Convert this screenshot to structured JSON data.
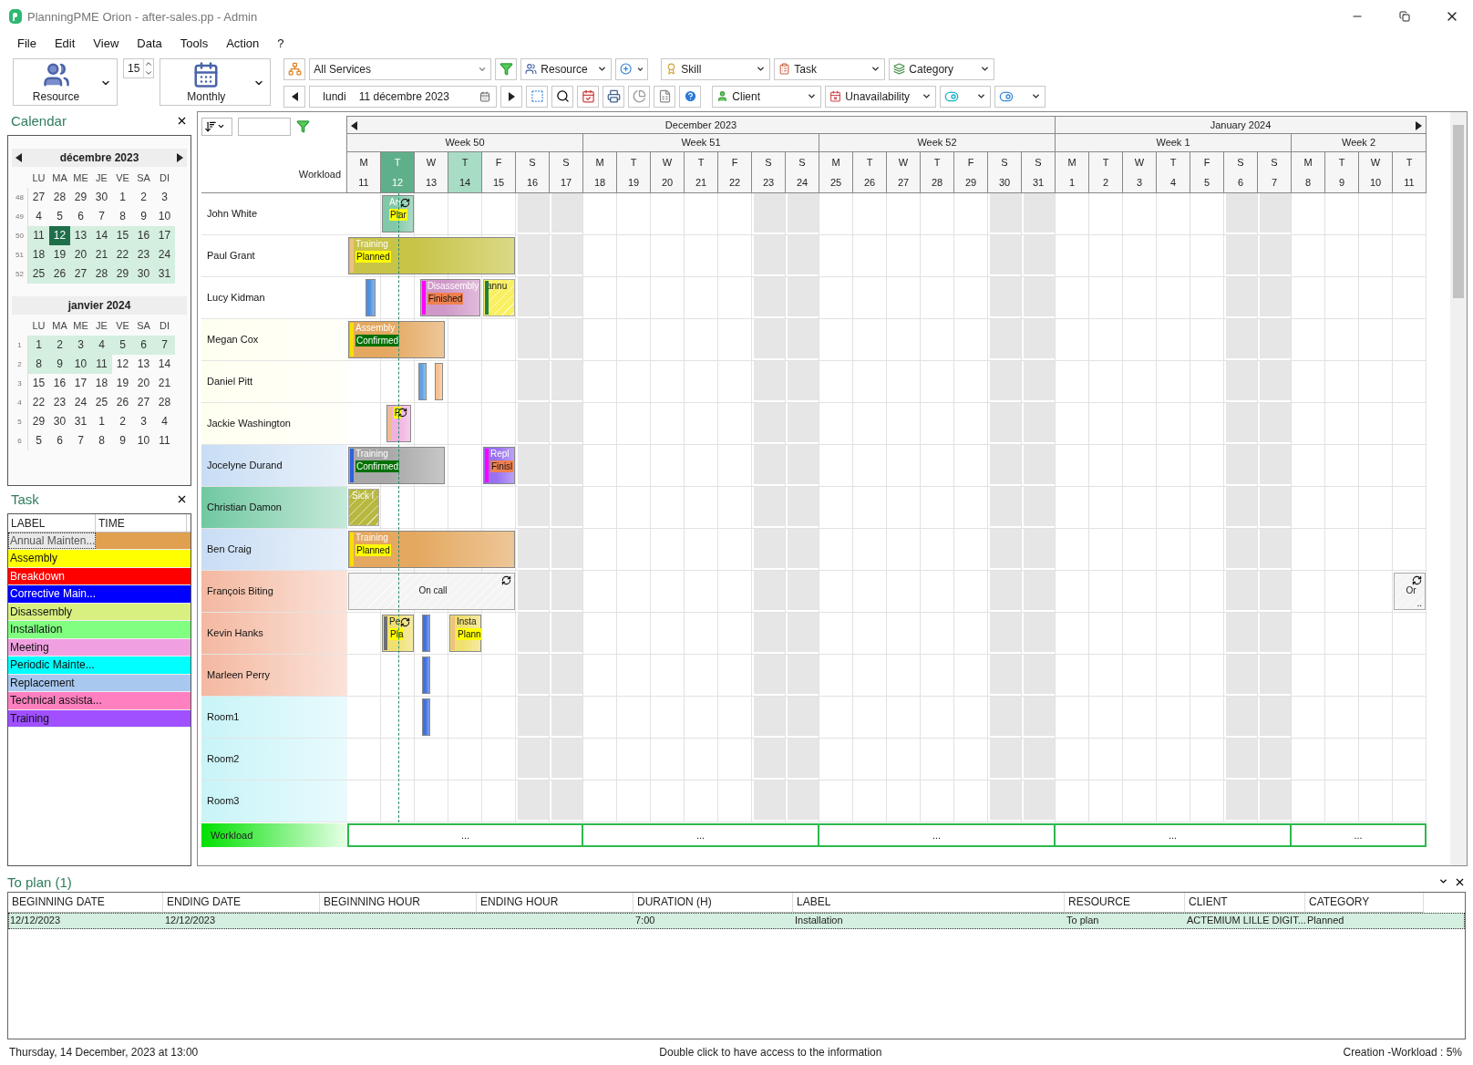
{
  "window": {
    "title": "PlanningPME Orion - after-sales.pp - Admin"
  },
  "menu": [
    "File",
    "Edit",
    "View",
    "Data",
    "Tools",
    "Action",
    "?"
  ],
  "toolbar": {
    "view_button": "Resource",
    "zoom": "15",
    "period_button": "Monthly",
    "services": "All Services",
    "resource_filter": "Resource",
    "skill": "Skill",
    "task": "Task",
    "category": "Category",
    "day_name": "lundi",
    "date": "11 décembre 2023",
    "client": "Client",
    "unavailability": "Unavailability"
  },
  "calendar": {
    "title": "Calendar",
    "months": [
      {
        "title": "décembre 2023",
        "weekday_headers": [
          "LU",
          "MA",
          "ME",
          "JE",
          "VE",
          "SA",
          "DI"
        ],
        "weeks": [
          {
            "number": "48",
            "days": [
              {
                "d": "27",
                "in_view": false,
                "selected": false
              },
              {
                "d": "28",
                "in_view": false,
                "selected": false
              },
              {
                "d": "29",
                "in_view": false,
                "selected": false
              },
              {
                "d": "30",
                "in_view": false,
                "selected": false
              },
              {
                "d": "1",
                "in_view": false,
                "selected": false
              },
              {
                "d": "2",
                "in_view": false,
                "selected": false
              },
              {
                "d": "3",
                "in_view": false,
                "selected": false
              }
            ]
          },
          {
            "number": "49",
            "days": [
              {
                "d": "4",
                "in_view": false,
                "selected": false
              },
              {
                "d": "5",
                "in_view": false,
                "selected": false
              },
              {
                "d": "6",
                "in_view": false,
                "selected": false
              },
              {
                "d": "7",
                "in_view": false,
                "selected": false
              },
              {
                "d": "8",
                "in_view": false,
                "selected": false
              },
              {
                "d": "9",
                "in_view": false,
                "selected": false
              },
              {
                "d": "10",
                "in_view": false,
                "selected": false
              }
            ]
          },
          {
            "number": "50",
            "days": [
              {
                "d": "11",
                "in_view": true,
                "selected": false
              },
              {
                "d": "12",
                "in_view": true,
                "selected": true
              },
              {
                "d": "13",
                "in_view": true,
                "selected": false
              },
              {
                "d": "14",
                "in_view": true,
                "selected": false
              },
              {
                "d": "15",
                "in_view": true,
                "selected": false
              },
              {
                "d": "16",
                "in_view": true,
                "selected": false
              },
              {
                "d": "17",
                "in_view": true,
                "selected": false
              }
            ]
          },
          {
            "number": "51",
            "days": [
              {
                "d": "18",
                "in_view": true,
                "selected": false
              },
              {
                "d": "19",
                "in_view": true,
                "selected": false
              },
              {
                "d": "20",
                "in_view": true,
                "selected": false
              },
              {
                "d": "21",
                "in_view": true,
                "selected": false
              },
              {
                "d": "22",
                "in_view": true,
                "selected": false
              },
              {
                "d": "23",
                "in_view": true,
                "selected": false
              },
              {
                "d": "24",
                "in_view": true,
                "selected": false
              }
            ]
          },
          {
            "number": "52",
            "days": [
              {
                "d": "25",
                "in_view": true,
                "selected": false
              },
              {
                "d": "26",
                "in_view": true,
                "selected": false
              },
              {
                "d": "27",
                "in_view": true,
                "selected": false
              },
              {
                "d": "28",
                "in_view": true,
                "selected": false
              },
              {
                "d": "29",
                "in_view": true,
                "selected": false
              },
              {
                "d": "30",
                "in_view": true,
                "selected": false
              },
              {
                "d": "31",
                "in_view": true,
                "selected": false
              }
            ]
          }
        ]
      },
      {
        "title": "janvier 2024",
        "weekday_headers": [
          "LU",
          "MA",
          "ME",
          "JE",
          "VE",
          "SA",
          "DI"
        ],
        "weeks": [
          {
            "number": "1",
            "days": [
              {
                "d": "1",
                "in_view": true,
                "selected": false
              },
              {
                "d": "2",
                "in_view": true,
                "selected": false
              },
              {
                "d": "3",
                "in_view": true,
                "selected": false
              },
              {
                "d": "4",
                "in_view": true,
                "selected": false
              },
              {
                "d": "5",
                "in_view": true,
                "selected": false
              },
              {
                "d": "6",
                "in_view": true,
                "selected": false
              },
              {
                "d": "7",
                "in_view": true,
                "selected": false
              }
            ]
          },
          {
            "number": "2",
            "days": [
              {
                "d": "8",
                "in_view": true,
                "selected": false
              },
              {
                "d": "9",
                "in_view": true,
                "selected": false
              },
              {
                "d": "10",
                "in_view": true,
                "selected": false
              },
              {
                "d": "11",
                "in_view": true,
                "selected": false
              },
              {
                "d": "12",
                "in_view": false,
                "selected": false
              },
              {
                "d": "13",
                "in_view": false,
                "selected": false
              },
              {
                "d": "14",
                "in_view": false,
                "selected": false
              }
            ]
          },
          {
            "number": "3",
            "days": [
              {
                "d": "15",
                "in_view": false,
                "selected": false
              },
              {
                "d": "16",
                "in_view": false,
                "selected": false
              },
              {
                "d": "17",
                "in_view": false,
                "selected": false
              },
              {
                "d": "18",
                "in_view": false,
                "selected": false
              },
              {
                "d": "19",
                "in_view": false,
                "selected": false
              },
              {
                "d": "20",
                "in_view": false,
                "selected": false
              },
              {
                "d": "21",
                "in_view": false,
                "selected": false
              }
            ]
          },
          {
            "number": "4",
            "days": [
              {
                "d": "22",
                "in_view": false,
                "selected": false
              },
              {
                "d": "23",
                "in_view": false,
                "selected": false
              },
              {
                "d": "24",
                "in_view": false,
                "selected": false
              },
              {
                "d": "25",
                "in_view": false,
                "selected": false
              },
              {
                "d": "26",
                "in_view": false,
                "selected": false
              },
              {
                "d": "27",
                "in_view": false,
                "selected": false
              },
              {
                "d": "28",
                "in_view": false,
                "selected": false
              }
            ]
          },
          {
            "number": "5",
            "days": [
              {
                "d": "29",
                "in_view": false,
                "selected": false
              },
              {
                "d": "30",
                "in_view": false,
                "selected": false
              },
              {
                "d": "31",
                "in_view": false,
                "selected": false
              },
              {
                "d": "1",
                "in_view": false,
                "selected": false
              },
              {
                "d": "2",
                "in_view": false,
                "selected": false
              },
              {
                "d": "3",
                "in_view": false,
                "selected": false
              },
              {
                "d": "4",
                "in_view": false,
                "selected": false
              }
            ]
          },
          {
            "number": "6",
            "days": [
              {
                "d": "5",
                "in_view": false,
                "selected": false
              },
              {
                "d": "6",
                "in_view": false,
                "selected": false
              },
              {
                "d": "7",
                "in_view": false,
                "selected": false
              },
              {
                "d": "8",
                "in_view": false,
                "selected": false
              },
              {
                "d": "9",
                "in_view": false,
                "selected": false
              },
              {
                "d": "10",
                "in_view": false,
                "selected": false
              },
              {
                "d": "11",
                "in_view": false,
                "selected": false
              }
            ]
          }
        ]
      }
    ]
  },
  "task_panel": {
    "title": "Task",
    "columns": [
      "LABEL",
      "TIME"
    ],
    "items": [
      {
        "label": "Annual Mainten...",
        "color": "#e0a050",
        "selected": true
      },
      {
        "label": "Assembly",
        "color": "#ffff00",
        "selected": false
      },
      {
        "label": "Breakdown",
        "color": "#ff0000",
        "selected": false
      },
      {
        "label": "Corrective Main...",
        "color": "#0000ff",
        "selected": false
      },
      {
        "label": "Disassembly",
        "color": "#d8f080",
        "selected": false
      },
      {
        "label": "Installation",
        "color": "#80ff80",
        "selected": false
      },
      {
        "label": "Meeting",
        "color": "#f0a0e0",
        "selected": false
      },
      {
        "label": "Periodic Mainte...",
        "color": "#00ffff",
        "selected": false
      },
      {
        "label": "Replacement",
        "color": "#a8c8f0",
        "selected": false
      },
      {
        "label": "Technical assista...",
        "color": "#ff80c0",
        "selected": false
      },
      {
        "label": "Training",
        "color": "#a050ff",
        "selected": false
      }
    ]
  },
  "planning": {
    "header_label": "Workload",
    "months": [
      {
        "label": "December 2023",
        "weeks": [
          {
            "label": "Week 50",
            "days": [
              {
                "letter": "M",
                "number": "11",
                "weekend": false,
                "today": false,
                "highlighted": false
              },
              {
                "letter": "T",
                "number": "12",
                "weekend": false,
                "today": true,
                "highlighted": false
              },
              {
                "letter": "W",
                "number": "13",
                "weekend": false,
                "today": false,
                "highlighted": false
              },
              {
                "letter": "T",
                "number": "14",
                "weekend": false,
                "today": false,
                "highlighted": true
              },
              {
                "letter": "F",
                "number": "15",
                "weekend": false,
                "today": false,
                "highlighted": false
              },
              {
                "letter": "S",
                "number": "16",
                "weekend": true,
                "today": false,
                "highlighted": false
              },
              {
                "letter": "S",
                "number": "17",
                "weekend": true,
                "today": false,
                "highlighted": false
              }
            ]
          },
          {
            "label": "Week 51",
            "days": [
              {
                "letter": "M",
                "number": "18",
                "weekend": false,
                "today": false,
                "highlighted": false
              },
              {
                "letter": "T",
                "number": "19",
                "weekend": false,
                "today": false,
                "highlighted": false
              },
              {
                "letter": "W",
                "number": "20",
                "weekend": false,
                "today": false,
                "highlighted": false
              },
              {
                "letter": "T",
                "number": "21",
                "weekend": false,
                "today": false,
                "highlighted": false
              },
              {
                "letter": "F",
                "number": "22",
                "weekend": false,
                "today": false,
                "highlighted": false
              },
              {
                "letter": "S",
                "number": "23",
                "weekend": true,
                "today": false,
                "highlighted": false
              },
              {
                "letter": "S",
                "number": "24",
                "weekend": true,
                "today": false,
                "highlighted": false
              }
            ]
          },
          {
            "label": "Week 52",
            "days": [
              {
                "letter": "M",
                "number": "25",
                "weekend": false,
                "today": false,
                "highlighted": false
              },
              {
                "letter": "T",
                "number": "26",
                "weekend": false,
                "today": false,
                "highlighted": false
              },
              {
                "letter": "W",
                "number": "27",
                "weekend": false,
                "today": false,
                "highlighted": false
              },
              {
                "letter": "T",
                "number": "28",
                "weekend": false,
                "today": false,
                "highlighted": false
              },
              {
                "letter": "F",
                "number": "29",
                "weekend": false,
                "today": false,
                "highlighted": false
              },
              {
                "letter": "S",
                "number": "30",
                "weekend": true,
                "today": false,
                "highlighted": false
              },
              {
                "letter": "S",
                "number": "31",
                "weekend": true,
                "today": false,
                "highlighted": false
              }
            ]
          }
        ]
      },
      {
        "label": "January 2024",
        "weeks": [
          {
            "label": "Week 1",
            "days": [
              {
                "letter": "M",
                "number": "1",
                "weekend": false,
                "today": false,
                "highlighted": false
              },
              {
                "letter": "T",
                "number": "2",
                "weekend": false,
                "today": false,
                "highlighted": false
              },
              {
                "letter": "W",
                "number": "3",
                "weekend": false,
                "today": false,
                "highlighted": false
              },
              {
                "letter": "T",
                "number": "4",
                "weekend": false,
                "today": false,
                "highlighted": false
              },
              {
                "letter": "F",
                "number": "5",
                "weekend": false,
                "today": false,
                "highlighted": false
              },
              {
                "letter": "S",
                "number": "6",
                "weekend": true,
                "today": false,
                "highlighted": false
              },
              {
                "letter": "S",
                "number": "7",
                "weekend": true,
                "today": false,
                "highlighted": false
              }
            ]
          },
          {
            "label": "Week 2",
            "days": [
              {
                "letter": "M",
                "number": "8",
                "weekend": false,
                "today": false,
                "highlighted": false
              },
              {
                "letter": "T",
                "number": "9",
                "weekend": false,
                "today": false,
                "highlighted": false
              },
              {
                "letter": "W",
                "number": "10",
                "weekend": false,
                "today": false,
                "highlighted": false
              },
              {
                "letter": "T",
                "number": "11",
                "weekend": false,
                "today": false,
                "highlighted": false
              }
            ]
          }
        ]
      }
    ],
    "resources": [
      {
        "name": "John White",
        "color": "#ffffff",
        "events": [
          {
            "kind": "task",
            "label": "An",
            "status": {
              "text": "Plar",
              "color": "#ffff00"
            },
            "color": "#80c8a8",
            "recurring": true
          }
        ]
      },
      {
        "name": "Paul Grant",
        "color": "#ffffff",
        "events": [
          {
            "kind": "task",
            "label": "Training",
            "status": {
              "text": "Planned",
              "color": "#ffff00"
            },
            "color": "#c8c448",
            "strip": {
              "color": "#f0c080"
            },
            "recurring": false
          }
        ]
      },
      {
        "name": "Lucy Kidman",
        "color": "#ffffff",
        "events": [
          {
            "kind": "task",
            "color": "#5090e0",
            "recurring": false
          },
          {
            "kind": "task",
            "label": "Disassembly",
            "status": {
              "text": "Finished",
              "color": "#f08050"
            },
            "color": "#d098c8",
            "strip": {
              "color": "#ff00ff"
            },
            "recurring": false
          },
          {
            "kind": "absence",
            "label": "annu",
            "color": "#f8f060",
            "strip": {
              "color": "#208040"
            },
            "recurring": false
          }
        ]
      },
      {
        "name": "Megan Cox",
        "color": "#fffff0",
        "events": [
          {
            "kind": "task",
            "label": "Assembly",
            "status": {
              "text": "Confirmed",
              "color": "#007000"
            },
            "color": "#e4a860",
            "strip": {
              "color": "#f8e000"
            },
            "recurring": false
          }
        ]
      },
      {
        "name": "Daniel Pitt",
        "color": "#fffff0",
        "events": [
          {
            "kind": "task",
            "color": "#60a0e0",
            "recurring": false
          },
          {
            "kind": "task",
            "color": "#f8c090",
            "recurring": false
          }
        ]
      },
      {
        "name": "Jackie Washington",
        "color": "#fffff0",
        "events": [
          {
            "kind": "task",
            "status": {
              "text": "F",
              "color": "#ffff00"
            },
            "color": "#f0b0e0",
            "strip": {
              "color": "#f0c080"
            },
            "recurring": true
          }
        ]
      },
      {
        "name": "Jocelyne Durand",
        "color": "#c8ddf4",
        "events": [
          {
            "kind": "task",
            "label": "Training",
            "status": {
              "text": "Confirmed",
              "color": "#007000"
            },
            "color": "#a8a8a8",
            "strip": {
              "color": "#3060e0"
            },
            "recurring": false
          },
          {
            "kind": "task",
            "label": "Repl",
            "status": {
              "text": "Finisl",
              "color": "#f08050"
            },
            "color": "#9870f0",
            "strip": {
              "color": "#ff00ff"
            },
            "recurring": false
          }
        ]
      },
      {
        "name": "Christian Damon",
        "color": "#70c8a0",
        "events": [
          {
            "kind": "absence",
            "label": "Sick l",
            "color": "#b8b840",
            "recurring": false
          }
        ]
      },
      {
        "name": "Ben Craig",
        "color": "#c8ddf4",
        "events": [
          {
            "kind": "task",
            "label": "Training",
            "status": {
              "text": "Planned",
              "color": "#ffff00"
            },
            "color": "#e4a860",
            "strip": {
              "color": "#f8e000"
            },
            "recurring": false
          }
        ]
      },
      {
        "name": "François Biting",
        "color": "#f4b8a0",
        "events": [
          {
            "kind": "absence",
            "label": "On call",
            "color": "#f4f4f4",
            "recurring": true
          },
          {
            "kind": "absence",
            "label": "Or",
            "more": "..",
            "color": "#f4f4f4",
            "recurring": true
          }
        ]
      },
      {
        "name": "Kevin Hanks",
        "color": "#f4b8a0",
        "events": [
          {
            "kind": "task",
            "label": "Pe",
            "status": {
              "text": "Pla",
              "color": "#ffff00"
            },
            "color": "#f0e070",
            "strip": {
              "color": "#707070"
            },
            "recurring": true
          },
          {
            "kind": "task",
            "color": "#4070e0",
            "recurring": false
          },
          {
            "kind": "task",
            "label": "Insta",
            "status": {
              "text": "Plann",
              "color": "#ffff00"
            },
            "color": "#f0e070",
            "strip": {
              "color": "#f0c080"
            },
            "recurring": false
          }
        ]
      },
      {
        "name": "Marleen Perry",
        "color": "#f4b8a0",
        "events": [
          {
            "kind": "task",
            "color": "#4070e0",
            "recurring": false
          }
        ]
      },
      {
        "name": "Room1",
        "color": "#c8f4f8",
        "events": [
          {
            "kind": "task",
            "color": "#4070e0",
            "recurring": false
          }
        ]
      },
      {
        "name": "Room2",
        "color": "#c8f4f8"
      },
      {
        "name": "Room3",
        "color": "#c8f4f8"
      }
    ],
    "workload": {
      "label": "Workload",
      "cells": [
        "...",
        "...",
        "...",
        "...",
        "..."
      ]
    }
  },
  "to_plan": {
    "title": "To plan (1)",
    "columns": [
      "BEGINNING DATE",
      "ENDING DATE",
      "BEGINNING HOUR",
      "ENDING HOUR",
      "DURATION (H)",
      "LABEL",
      "RESOURCE",
      "CLIENT",
      "CATEGORY"
    ],
    "rows": [
      {
        "selected": true,
        "cells": [
          "12/12/2023",
          "12/12/2023",
          null,
          null,
          "7:00",
          "Installation",
          "To plan",
          "ACTEMIUM LILLE DIGIT...",
          "Planned"
        ]
      }
    ]
  },
  "status_bar": {
    "left": "Thursday, 14 December, 2023 at 13:00",
    "center": "Double click to have access to the information",
    "right": "Creation -Workload : 5%"
  }
}
